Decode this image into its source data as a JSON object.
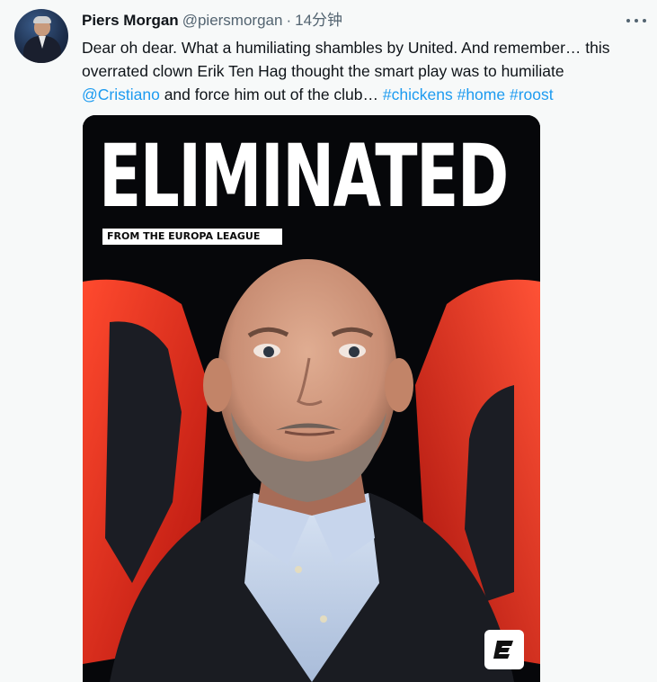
{
  "author": {
    "name": "Piers Morgan",
    "handle": "@piersmorgan",
    "separator": "·",
    "time": "14分钟"
  },
  "tweet": {
    "text_1": "Dear oh dear. What a humiliating shambles by United. And remember… this overrated clown Erik Ten Hag thought the smart play was to humiliate ",
    "mention": "@Cristiano",
    "text_2": " and force him out of the club… ",
    "hashtags": [
      "#chickens",
      "#home",
      "#roost"
    ]
  },
  "media": {
    "headline": "ELIMINATED",
    "banner": "FROM THE EUROPA LEAGUE",
    "logo": "E"
  },
  "colors": {
    "link": "#1d9bf0",
    "seat": "#e0261c",
    "background": "#f7f9f9"
  },
  "icons": {
    "more": "more-dots-icon",
    "logo": "espn-logo-icon"
  }
}
